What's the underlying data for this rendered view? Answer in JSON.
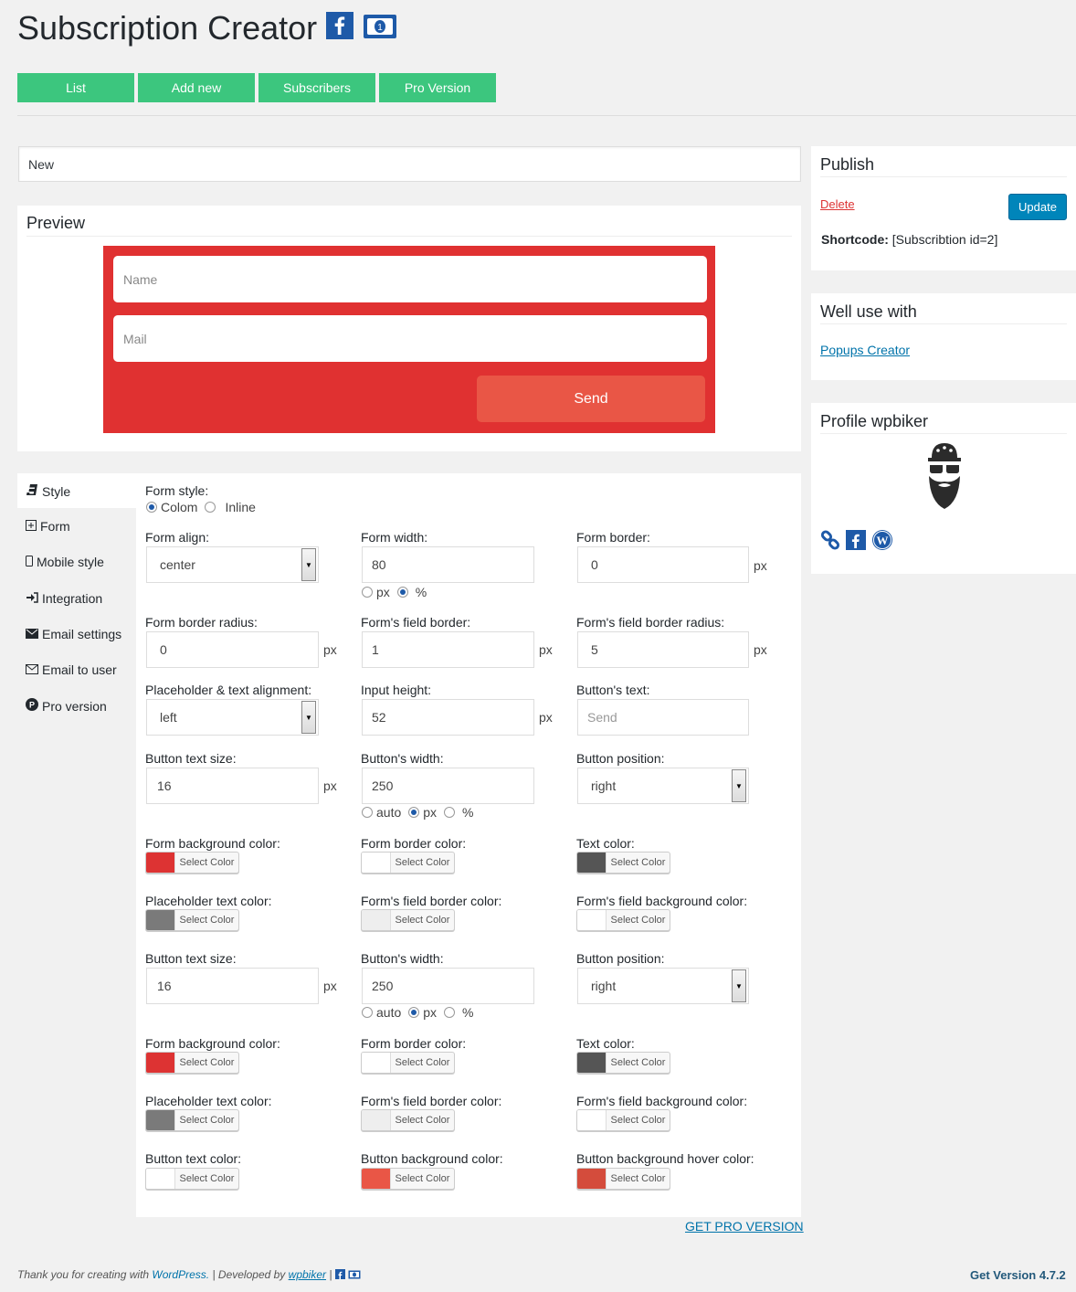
{
  "header": {
    "title": "Subscription Creator",
    "icons": [
      "facebook-icon",
      "money-icon"
    ]
  },
  "nav": [
    "List",
    "Add new",
    "Subscribers",
    "Pro Version"
  ],
  "post_title": "New",
  "preview": {
    "title": "Preview",
    "name_placeholder": "Name",
    "mail_placeholder": "Mail",
    "send_label": "Send",
    "form_bg": "#e03131",
    "button_bg": "#e95646"
  },
  "tabs": [
    {
      "icon": "css3-icon",
      "label": "Style"
    },
    {
      "icon": "plus-square-icon",
      "label": "Form"
    },
    {
      "icon": "mobile-icon",
      "label": "Mobile style"
    },
    {
      "icon": "sign-in-icon",
      "label": "Integration"
    },
    {
      "icon": "envelope-icon",
      "label": "Email settings"
    },
    {
      "icon": "envelope-o-icon",
      "label": "Email to user"
    },
    {
      "icon": "pro-icon",
      "label": "Pro version"
    }
  ],
  "settings": {
    "form_style_label": "Form style:",
    "form_style_options": [
      "Colom",
      "Inline"
    ],
    "form_align_label": "Form align:",
    "form_align_value": "center",
    "form_width_label": "Form width:",
    "form_width_value": "80",
    "form_width_units": [
      "px",
      "%"
    ],
    "form_border_label": "Form border:",
    "form_border_value": "0",
    "form_border_radius_label": "Form border radius:",
    "form_border_radius_value": "0",
    "field_border_label": "Form's field border:",
    "field_border_value": "1",
    "field_border_radius_label": "Form's field border radius:",
    "field_border_radius_value": "5",
    "placeholder_align_label": "Placeholder & text alignment:",
    "placeholder_align_value": "left",
    "input_height_label": "Input height:",
    "input_height_value": "52",
    "button_text_label": "Button's text:",
    "button_text_placeholder": "Send",
    "button_text_size_label": "Button text size:",
    "button_text_size_value": "16",
    "button_width_label": "Button's width:",
    "button_width_value": "250",
    "button_width_units": [
      "auto",
      "px",
      "%"
    ],
    "button_position_label": "Button position:",
    "button_position_value": "right",
    "unit_px": "px",
    "select_color": "Select Color",
    "colors": {
      "form_bg_label": "Form background color:",
      "form_bg": "#dd3333",
      "form_border_label": "Form border color:",
      "form_border": "#ffffff",
      "text_color_label": "Text color:",
      "text_color": "#555555",
      "placeholder_label": "Placeholder text color:",
      "placeholder": "#7a7a7a",
      "field_border_label": "Form's field border color:",
      "field_border": "#eeeeee",
      "field_bg_label": "Form's field background color:",
      "field_bg": "#ffffff",
      "button_text_label": "Button text color:",
      "button_text": "#ffffff",
      "button_bg_label": "Button background color:",
      "button_bg": "#e95646",
      "button_hover_label": "Button background hover color:",
      "button_hover": "#d44c3c"
    }
  },
  "get_pro": "GET PRO VERSION",
  "publish": {
    "title": "Publish",
    "delete": "Delete",
    "update": "Update",
    "shortcode_label": "Shortcode:",
    "shortcode_value": "[Subscribtion id=2]"
  },
  "well_use": {
    "title": "Well use with",
    "link": "Popups Creator"
  },
  "profile": {
    "title": "Profile wpbiker",
    "links": [
      "link-icon",
      "facebook-icon",
      "wordpress-icon"
    ]
  },
  "footer": {
    "thanks": "Thank you for creating with",
    "wordpress": "WordPress.",
    "sep": "|",
    "developed": "Developed by",
    "wpbiker": "wpbiker",
    "version": "Get Version 4.7.2"
  }
}
